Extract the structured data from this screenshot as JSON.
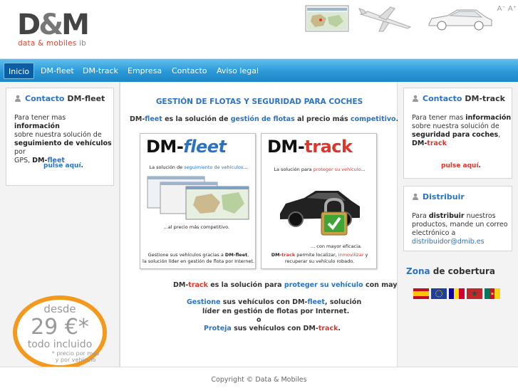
{
  "header": {
    "logo_mark_left": "D",
    "logo_amp": "&",
    "logo_mark_right": "M",
    "logo_sub_main": "data & mobiles",
    "logo_sub_suffix": "ib",
    "font_tools": "A⁻ A⁺"
  },
  "nav": {
    "items": [
      {
        "label": "Inicio",
        "active": true
      },
      {
        "label": "DM-fleet"
      },
      {
        "label": "DM-track"
      },
      {
        "label": "Empresa"
      },
      {
        "label": "Contacto"
      },
      {
        "label": "Aviso legal"
      }
    ]
  },
  "left": {
    "contact_title_blue": "Contacto",
    "contact_title_rest": "DM-fleet",
    "l1_a": "Para tener mas ",
    "l1_b": "información",
    "l2": "sobre nuestra solución de",
    "l3_a": "seguimiento de vehículos",
    "l3_b": " por",
    "l4_a": "GPS, ",
    "l4_b": "DM-",
    "l4_c": "fleet",
    "link": "pulse aquí",
    "link_dot": ".",
    "promo_line1": "desde",
    "promo_line2": "29 €*",
    "promo_line3": "todo incluido",
    "promo_line4": "* precio por mes",
    "promo_line5": "y por vehículo"
  },
  "center": {
    "title": "GESTIÓN DE FLOTAS Y SEGURIDAD PARA COCHES",
    "intro_a": "DM-",
    "intro_b": "fleet",
    "intro_c": " es la solución de ",
    "intro_d": "gestión de flotas",
    "intro_e": " al precio más ",
    "intro_f": "competitivo",
    "intro_g": ".",
    "fleet_card": {
      "dm": "DM",
      "dash": "-",
      "name": "fleet",
      "l1_a": "La solución de ",
      "l1_b": "seguimiento de vehículos",
      "l1_c": "...",
      "l2": "...al precio más competitivo.",
      "l3_a": "Gestione sus vehículos gracias a ",
      "l3_b": "DM-fleet",
      "l3_c": ",",
      "l4": "la solución líder en gestión de flota por Internet."
    },
    "track_card": {
      "dm": "DM",
      "dash": "-",
      "name": "track",
      "l1_a": "La solución para ",
      "l1_b": "proteger su vehículo",
      "l1_c": "...",
      "l2": "... con mayor eficacia.",
      "l3_a": "DM-",
      "l3_b": "track",
      "l3_c": " permite localizar, ",
      "l3_d": "inmovilizar",
      "l3_e": " y",
      "l4": "recuperar su vehículo robado."
    },
    "track_line_a": "DM-",
    "track_line_b": "track",
    "track_line_c": " es la solución para ",
    "track_line_d": "proteger su vehículo",
    "track_line_e": " con mayor eficacia.",
    "g1_a": "Gestione",
    "g1_b": " sus vehículos con DM-",
    "g1_c": "fleet",
    "g1_d": ", solución",
    "g2": "líder en gestión de flotas por Internet.",
    "g3": "o",
    "g4_a": "Proteja",
    "g4_b": " sus vehículos con DM-",
    "g4_c": "track",
    "g4_d": "."
  },
  "right": {
    "contact_title_blue": "Contacto",
    "contact_title_rest": "DM-track",
    "r1_a": "Para tener mas ",
    "r1_b": "información",
    "r2": "sobre nuestra solución de",
    "r3": "seguridad para coches",
    "r3_c": ",",
    "r4_a": "DM-",
    "r4_b": "track",
    "link": "pulse aquí",
    "link_dot": ".",
    "dist_title": "Distribuir",
    "d1_a": "Para ",
    "d1_b": "distribuir",
    "d1_c": " nuestros",
    "d2": "productos, mande un correo",
    "d3": "electrónico a",
    "d4": "distribuidor@dmib.es",
    "zona_a": "Zona",
    "zona_b": " de cobertura"
  },
  "footer": {
    "text": "Copyright © Data & Mobiles"
  },
  "colors": {
    "accent_blue": "#2a73c2",
    "accent_red": "#e0352b",
    "nav_blue": "#2b98d6"
  }
}
